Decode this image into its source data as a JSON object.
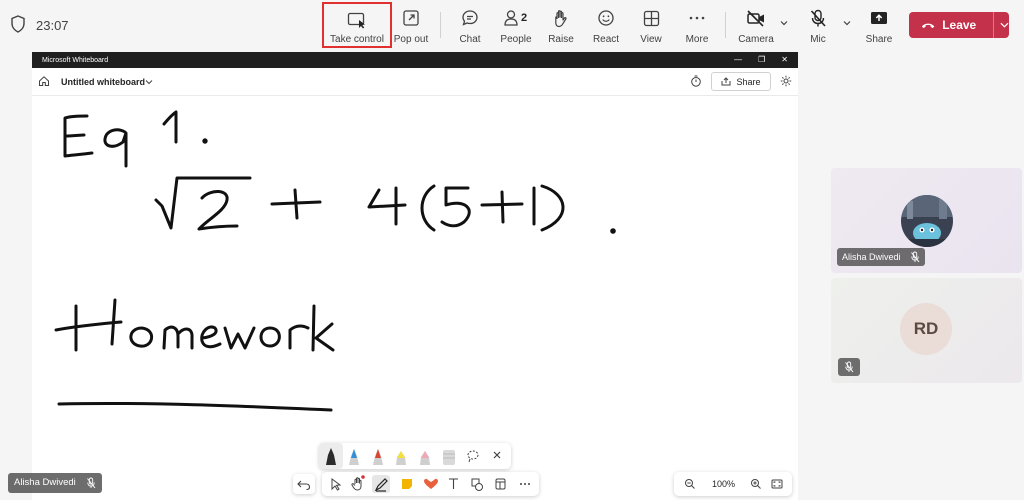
{
  "meeting": {
    "timer": "23:07"
  },
  "toolbar": {
    "take_control": "Take control",
    "pop_out": "Pop out",
    "chat": "Chat",
    "people": "People",
    "people_count": "2",
    "raise": "Raise",
    "react": "React",
    "view": "View",
    "more": "More",
    "camera": "Camera",
    "mic": "Mic",
    "share": "Share",
    "leave": "Leave"
  },
  "whiteboard": {
    "app_title": "Microsoft Whiteboard",
    "board_title": "Untitled whiteboard",
    "share": "Share",
    "zoom": "100%",
    "handwriting": [
      "Eq 1.",
      "√2 + 4(5+1)",
      "Homework"
    ]
  },
  "participants": {
    "self_name": "Alisha Dwivedi",
    "tiles": [
      {
        "name": "Alisha Dwivedi",
        "initials": ""
      },
      {
        "name": "",
        "initials": "RD"
      }
    ]
  },
  "colors": {
    "leave_red": "#c4314b",
    "highlight_red": "#e03030",
    "titlebar": "#1f1f1f"
  },
  "icons": {
    "take_control": "screen-cursor-icon",
    "pop_out": "pop-out-icon",
    "chat": "chat-bubble-icon",
    "people": "people-icon",
    "raise": "hand-icon",
    "react": "smiley-icon",
    "view": "grid-icon",
    "more": "more-dots-icon",
    "camera": "camera-off-icon",
    "mic": "mic-off-icon",
    "share": "share-tray-icon"
  }
}
